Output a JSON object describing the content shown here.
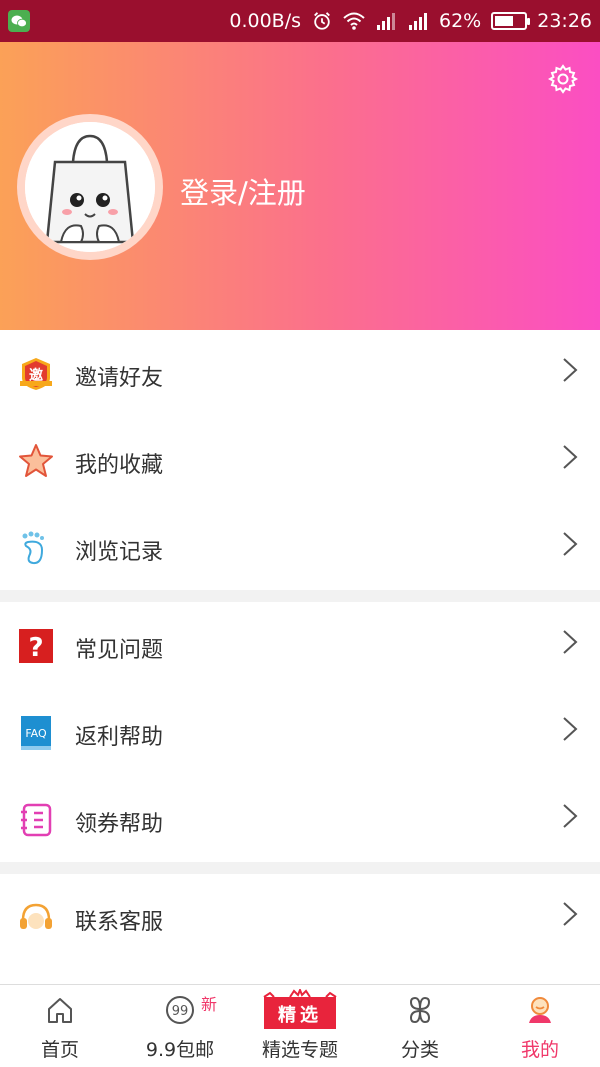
{
  "status_bar": {
    "network_speed": "0.00B/s",
    "battery": "62%",
    "battery_level": 0.62,
    "time": "23:26",
    "icons": [
      "wechat-icon",
      "alarm-icon",
      "wifi-icon",
      "signal-icon",
      "signal-icon",
      "battery-icon"
    ]
  },
  "header": {
    "login_label": "登录/注册",
    "settings_icon": "gear-icon",
    "avatar_icon": "shopping-bag-mascot"
  },
  "menu": {
    "group1": [
      {
        "label": "邀请好友",
        "icon": "invite-badge-icon"
      },
      {
        "label": "我的收藏",
        "icon": "star-icon"
      },
      {
        "label": "浏览记录",
        "icon": "footprint-icon"
      }
    ],
    "group2": [
      {
        "label": "常见问题",
        "icon": "question-icon"
      },
      {
        "label": "返利帮助",
        "icon": "faq-book-icon"
      },
      {
        "label": "领券帮助",
        "icon": "coupon-book-icon"
      }
    ],
    "group3": [
      {
        "label": "联系客服",
        "icon": "headset-icon"
      }
    ]
  },
  "tabbar": {
    "tabs": [
      {
        "label": "首页",
        "icon": "home-icon"
      },
      {
        "label": "9.9包邮",
        "icon": "nine-nine-icon",
        "badge": "新"
      },
      {
        "label": "精选专题",
        "icon": "featured-icon",
        "icon_text": "精选"
      },
      {
        "label": "分类",
        "icon": "category-icon"
      },
      {
        "label": "我的",
        "icon": "profile-icon",
        "active": true
      }
    ]
  },
  "colors": {
    "status_bar": "#9a0f2e",
    "gradient_start": "#fba157",
    "gradient_end": "#fb4ec3",
    "accent": "#f0386a"
  }
}
